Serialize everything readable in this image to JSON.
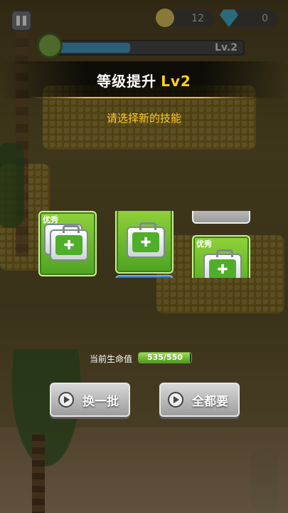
{
  "hud": {
    "coins": "12",
    "gems": "0",
    "level_badge": "Lv.2",
    "xp_fraction": 0.42
  },
  "dialog": {
    "title": "等级提升",
    "title_level": "Lv2",
    "subtitle": "请选择新的技能"
  },
  "cards": [
    {
      "tag": "优秀",
      "icon": "double-toolbox-icon"
    },
    {
      "tag": "",
      "icon": "toolbox-wrench-icon"
    },
    {
      "tag": "优秀",
      "icon": "medkit-icon"
    }
  ],
  "hp": {
    "label": "当前生命值",
    "value": "535/550",
    "fraction": 0.973
  },
  "buttons": {
    "refresh_label": "换一批",
    "take_all_label": "全都要"
  },
  "colors": {
    "accent_gold": "#ffd21a",
    "card_green": "#6bc02e",
    "button_grey": "#b5b5b5"
  }
}
